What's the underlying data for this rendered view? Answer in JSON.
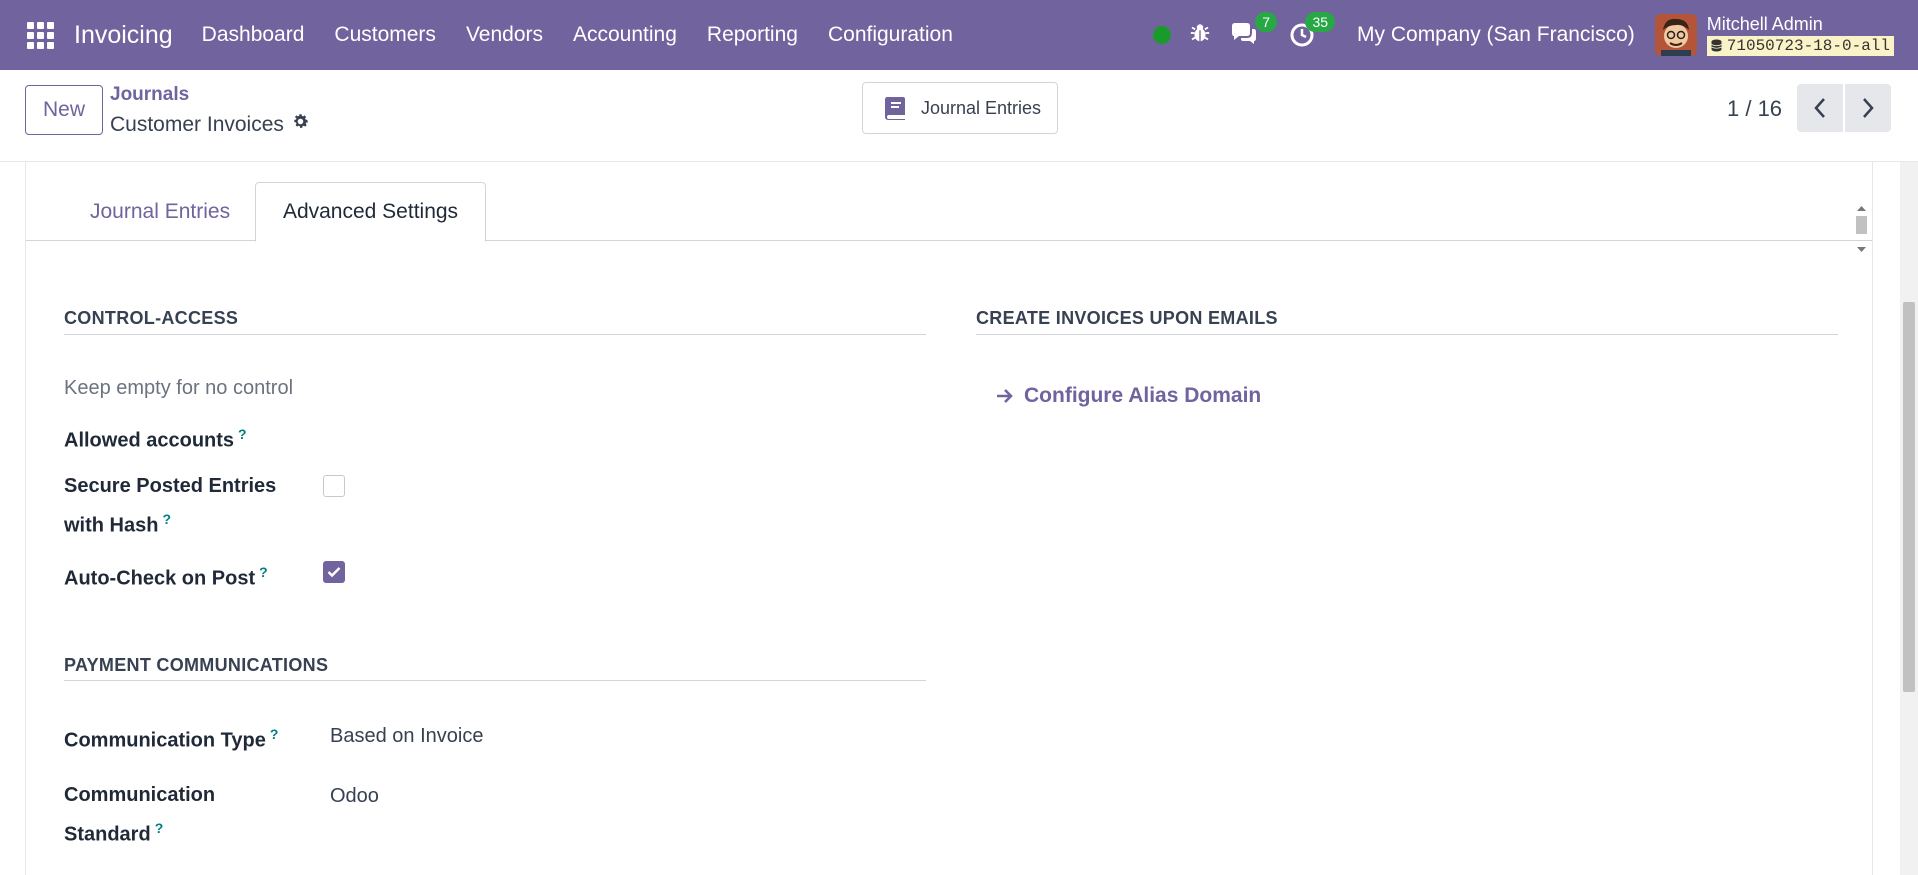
{
  "navbar": {
    "app_name": "Invoicing",
    "menu": [
      "Dashboard",
      "Customers",
      "Vendors",
      "Accounting",
      "Reporting",
      "Configuration"
    ],
    "messages_count": "7",
    "activities_count": "35",
    "company": "My Company (San Francisco)",
    "user_name": "Mitchell Admin",
    "db_name": "71050723-18-0-all",
    "colors": {
      "bar": "#71639e",
      "presence": "#1b9a2c",
      "badge": "#28a745"
    }
  },
  "control_panel": {
    "new_label": "New",
    "breadcrumb_parent": "Journals",
    "record_title": "Customer Invoices",
    "smart_button_label": "Journal Entries",
    "pager": "1 / 16"
  },
  "tabs": [
    {
      "label": "Journal Entries",
      "active": false
    },
    {
      "label": "Advanced Settings",
      "active": true
    }
  ],
  "control_access": {
    "title": "CONTROL-ACCESS",
    "hint": "Keep empty for no control",
    "allowed_accounts_label": "Allowed accounts",
    "secure_label_line1": "Secure Posted Entries",
    "secure_label_line2": "with Hash",
    "secure_checked": false,
    "autocheck_label": "Auto-Check on Post",
    "autocheck_checked": true
  },
  "create_invoices": {
    "title": "CREATE INVOICES UPON EMAILS",
    "link_label": "Configure Alias Domain"
  },
  "payment_communications": {
    "title": "PAYMENT COMMUNICATIONS",
    "type_label": "Communication Type",
    "type_value": "Based on Invoice",
    "standard_label_line1": "Communication",
    "standard_label_line2": "Standard",
    "standard_value": "Odoo"
  },
  "help_marker": "?"
}
